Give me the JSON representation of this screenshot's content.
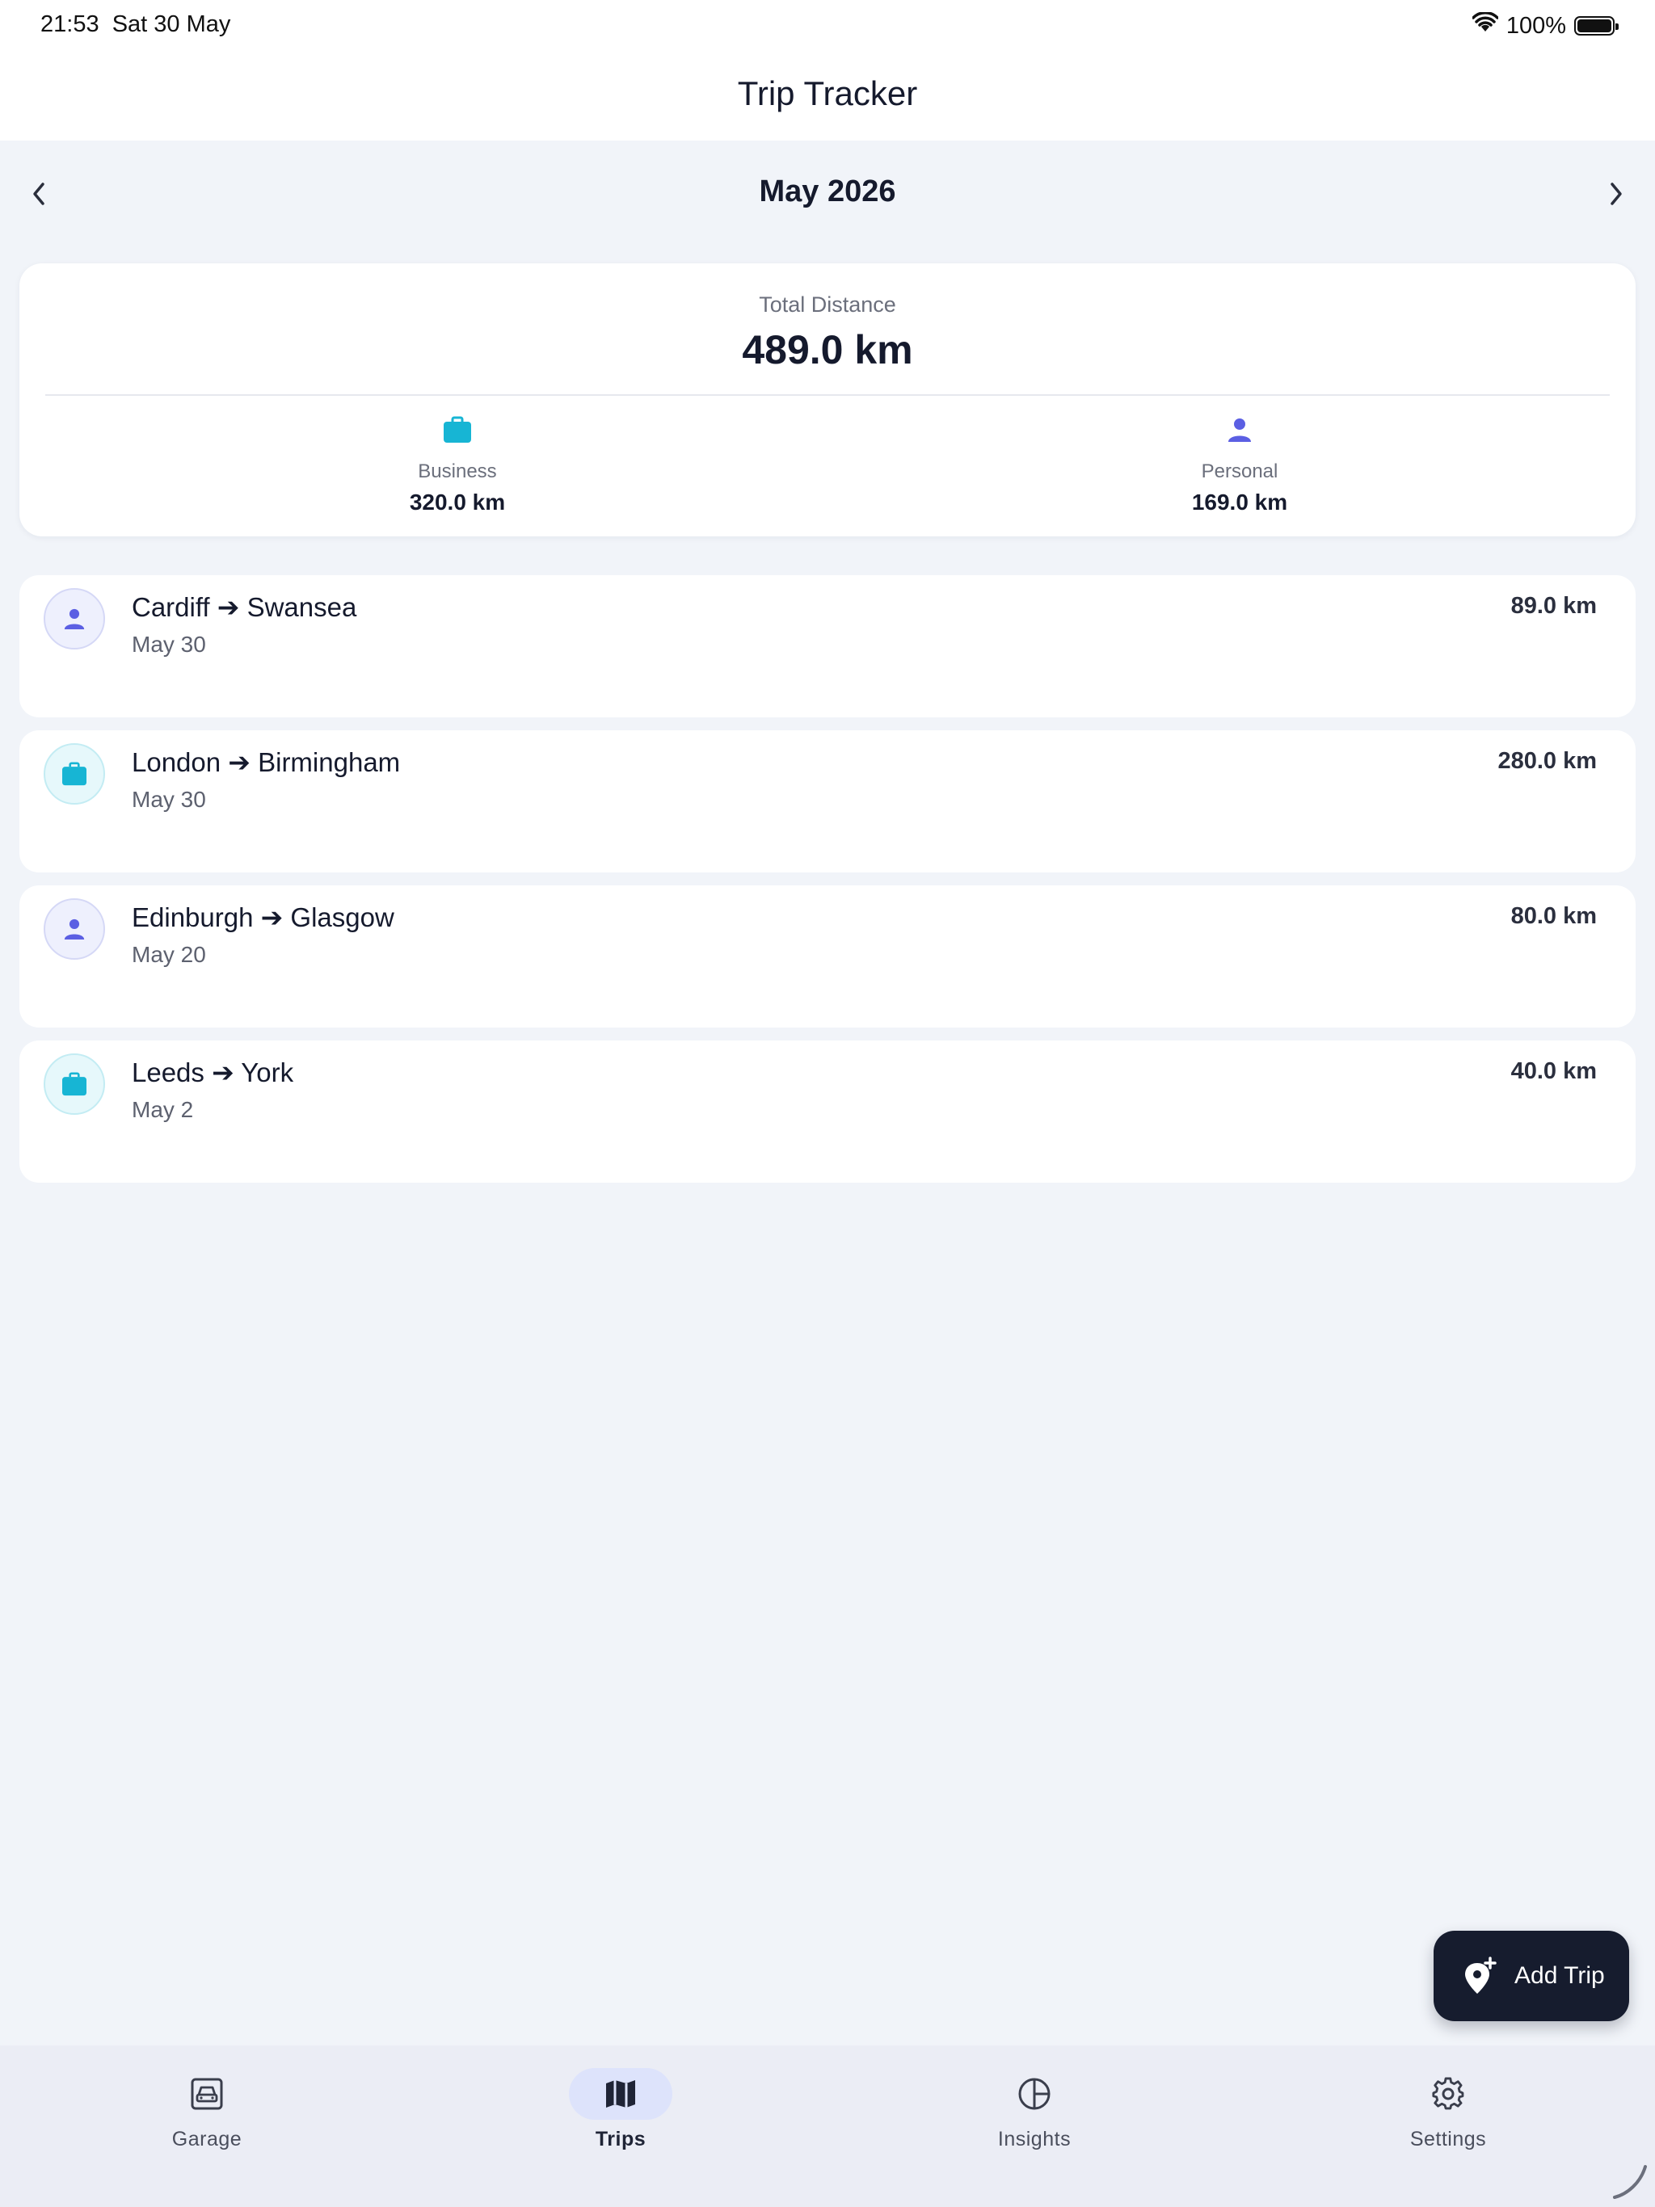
{
  "status_bar": {
    "time": "21:53",
    "date": "Sat 30 May",
    "battery": "100%",
    "battery_level": 1.0
  },
  "header": {
    "title": "Trip Tracker"
  },
  "month_nav": {
    "label": "May 2026",
    "prev_icon": "chevron-left-icon",
    "next_icon": "chevron-right-icon"
  },
  "summary": {
    "total_label": "Total Distance",
    "total_value": "489.0 km",
    "business": {
      "label": "Business",
      "value": "320.0 km",
      "icon": "briefcase-icon"
    },
    "personal": {
      "label": "Personal",
      "value": "169.0 km",
      "icon": "person-icon"
    }
  },
  "trips": [
    {
      "route": "Cardiff ➔ Swansea",
      "date": "May 30",
      "distance": "89.0 km",
      "type": "personal"
    },
    {
      "route": "London ➔ Birmingham",
      "date": "May 30",
      "distance": "280.0 km",
      "type": "business"
    },
    {
      "route": "Edinburgh ➔ Glasgow",
      "date": "May 20",
      "distance": "80.0 km",
      "type": "personal"
    },
    {
      "route": "Leeds ➔ York",
      "date": "May 2",
      "distance": "40.0 km",
      "type": "business"
    }
  ],
  "fab": {
    "label": "Add Trip",
    "icon": "add-location-icon"
  },
  "tabs": [
    {
      "label": "Garage",
      "icon": "car-icon",
      "active": false
    },
    {
      "label": "Trips",
      "icon": "map-icon",
      "active": true
    },
    {
      "label": "Insights",
      "icon": "pie-chart-icon",
      "active": false
    },
    {
      "label": "Settings",
      "icon": "gear-icon",
      "active": false
    }
  ],
  "colors": {
    "personal": "#5b5fe3",
    "business": "#17b5d4",
    "dark": "#161c2e",
    "background": "#f1f4f9"
  }
}
